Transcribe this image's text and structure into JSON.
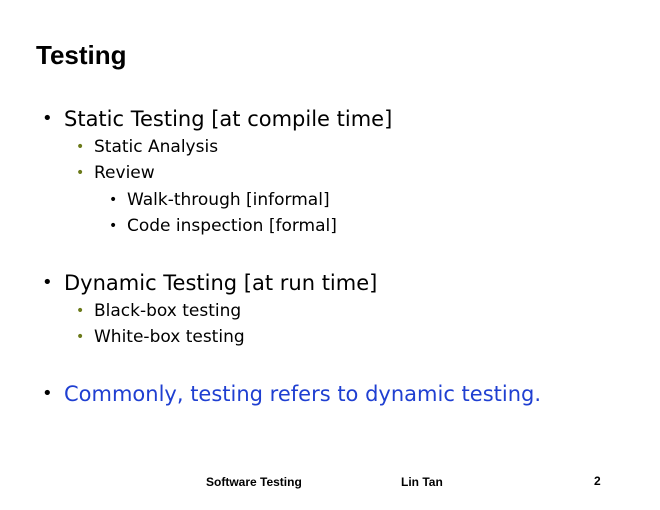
{
  "title": "Testing",
  "sections": [
    {
      "label": "Static Testing [at compile time]",
      "items": [
        {
          "label": "Static Analysis"
        },
        {
          "label": "Review",
          "items": [
            {
              "label": "Walk-through [informal]"
            },
            {
              "label": "Code inspection [formal]"
            }
          ]
        }
      ]
    },
    {
      "label": "Dynamic Testing [at run time]",
      "items": [
        {
          "label": "Black-box testing"
        },
        {
          "label": "White-box testing"
        }
      ]
    },
    {
      "label": "Commonly, testing refers to dynamic testing."
    }
  ],
  "bullet_char": "•",
  "colors": {
    "accent_text": "#1f3fd1",
    "sub_bullet": "#6b7a1a"
  },
  "footer": {
    "course": "Software Testing",
    "author": "Lin Tan",
    "page_number": "2"
  }
}
